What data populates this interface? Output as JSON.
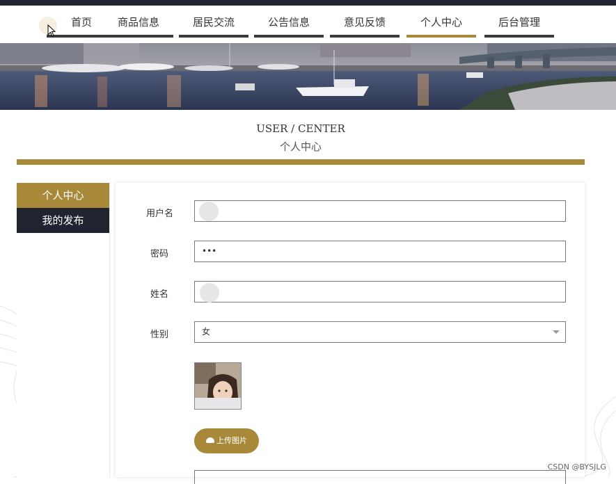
{
  "nav": {
    "items": [
      {
        "label": "首页"
      },
      {
        "label": "商品信息"
      },
      {
        "label": "居民交流"
      },
      {
        "label": "公告信息"
      },
      {
        "label": "意见反馈"
      },
      {
        "label": "个人中心"
      },
      {
        "label": "后台管理"
      }
    ],
    "active_index": 5
  },
  "page": {
    "title_en": "USER / CENTER",
    "title_cn": "个人中心"
  },
  "sidebar": {
    "items": [
      {
        "label": "个人中心"
      },
      {
        "label": "我的发布"
      }
    ]
  },
  "form": {
    "username_label": "用户名",
    "username_value": "",
    "password_label": "密码",
    "password_value": "•••",
    "name_label": "姓名",
    "name_value": "",
    "gender_label": "性别",
    "gender_value": "女",
    "upload_label": "上传图片"
  },
  "watermark": "CSDN @BYSJLG",
  "colors": {
    "accent": "#a8893a",
    "dark": "#1f2430"
  }
}
